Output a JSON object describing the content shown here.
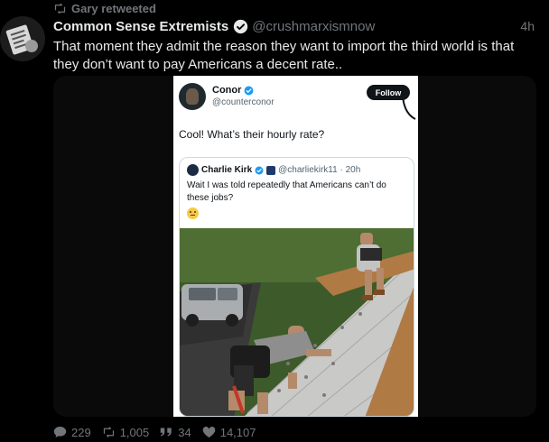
{
  "retweet": {
    "label": "Gary retweeted"
  },
  "tweet": {
    "display_name": "Common Sense Extremists",
    "handle": "@crushmarxismnow",
    "time": "4h",
    "text": "That moment they admit the reason they want to import the third world is that they don’t want to pay Americans a decent rate.."
  },
  "embedded": {
    "name": "Conor",
    "handle": "@counterconor",
    "follow_label": "Follow",
    "reply_text": "Cool!  What’s their hourly rate?",
    "quote": {
      "name": "Charlie Kirk",
      "meta": "@charliekirk11 · 20h",
      "text": "Wait I was told repeatedly that Americans can’t do these jobs?"
    }
  },
  "stats": {
    "replies": "229",
    "retweets": "1,005",
    "quotes": "34",
    "likes": "14,107"
  },
  "colors": {
    "background": "#000000",
    "text": "#e7e9ea",
    "muted": "#71767b",
    "verified": "#1d9bf0"
  },
  "icons": [
    "retweet-icon",
    "verified-icon",
    "reply-icon",
    "quote-icon",
    "like-icon",
    "thinking-emoji-icon"
  ]
}
